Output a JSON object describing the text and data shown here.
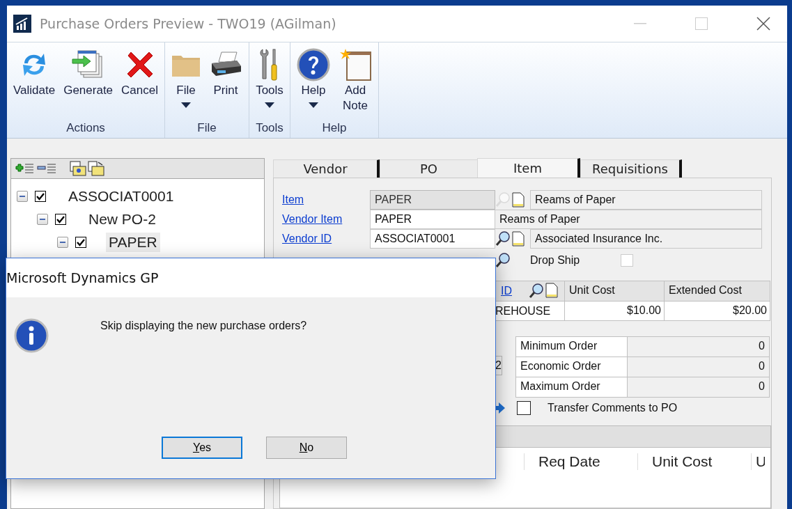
{
  "window": {
    "title": "Purchase Orders Preview  -  TWO19 (AGilman)"
  },
  "ribbon": {
    "groups": [
      {
        "label": "Actions",
        "buttons": [
          {
            "label": "Validate",
            "kind": "refresh",
            "dropdown": false
          },
          {
            "label": "Generate",
            "kind": "generate",
            "dropdown": false
          },
          {
            "label": "Cancel",
            "kind": "cancel",
            "dropdown": false
          }
        ]
      },
      {
        "label": "File",
        "buttons": [
          {
            "label": "File",
            "kind": "folder",
            "dropdown": true
          },
          {
            "label": "Print",
            "kind": "printer",
            "dropdown": false
          }
        ]
      },
      {
        "label": "Tools",
        "buttons": [
          {
            "label": "Tools",
            "kind": "tools",
            "dropdown": true
          }
        ]
      },
      {
        "label": "Help",
        "buttons": [
          {
            "label": "Help",
            "kind": "help",
            "dropdown": true
          },
          {
            "label": "Add Note",
            "kind": "note",
            "dropdown": false
          }
        ]
      }
    ]
  },
  "tree": {
    "items": [
      {
        "label": "ASSOCIAT0001",
        "checked": true,
        "selected": false,
        "expanded": true,
        "children": [
          {
            "label": "New PO-2",
            "checked": true,
            "selected": false,
            "expanded": true,
            "children": [
              {
                "label": "PAPER",
                "checked": true,
                "selected": true,
                "expanded": true
              }
            ]
          }
        ]
      }
    ]
  },
  "tabs": [
    {
      "label": "Vendor",
      "selected": false
    },
    {
      "label": "PO",
      "selected": false
    },
    {
      "label": "Item",
      "selected": true
    },
    {
      "label": "Requisitions",
      "selected": false
    }
  ],
  "fields": [
    {
      "label": "Item",
      "value": "PAPER",
      "kind": "lookup-disabled",
      "editable": false,
      "description": "Reams of Paper"
    },
    {
      "label": "Vendor Item",
      "value": "PAPER",
      "kind": "plain",
      "editable": true,
      "description": "Reams of Paper"
    },
    {
      "label": "Vendor ID",
      "value": "ASSOCIAT0001",
      "kind": "lookup",
      "editable": true,
      "description": "Associated Insurance Inc."
    }
  ],
  "drop_ship": {
    "label": "Drop Ship",
    "checked": false
  },
  "cost_grid": {
    "id_link": "ID",
    "columns": [
      "Unit Cost",
      "Extended Cost"
    ],
    "row": [
      "REHOUSE",
      "$10.00",
      "$20.00"
    ]
  },
  "partial_value": "2",
  "order_quantities": [
    {
      "label": "Minimum Order",
      "value": "0"
    },
    {
      "label": "Economic Order",
      "value": "0"
    },
    {
      "label": "Maximum Order",
      "value": "0"
    }
  ],
  "transfer_comments": {
    "label": "Transfer Comments to PO",
    "checked": false
  },
  "requisition_grid": {
    "columns": [
      "Req Date",
      "Unit Cost",
      "U"
    ]
  },
  "dialog": {
    "title": "Microsoft Dynamics GP",
    "message": "Skip displaying the new purchase orders?",
    "buttons": [
      {
        "label": "Yes",
        "selected": true
      },
      {
        "label": "No",
        "selected": false
      }
    ]
  }
}
